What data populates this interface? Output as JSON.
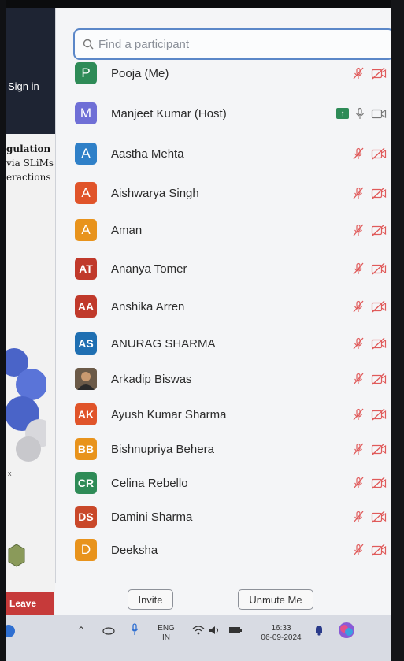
{
  "meeting": {
    "signin_label": "Sign in",
    "slide_title_lines": [
      "gulation",
      "via SLiMs",
      "eractions"
    ],
    "slide_small_text": "x",
    "leave_label": "Leave"
  },
  "panel": {
    "search_placeholder": "Find a participant",
    "invite_label": "Invite",
    "unmute_label": "Unmute Me",
    "participants": [
      {
        "initials": "P",
        "name": "Pooja (Me)",
        "color": "#2e8b57"
      },
      {
        "initials": "M",
        "name": "Manjeet Kumar (Host)",
        "color": "#6f6fd6"
      },
      {
        "initials": "A",
        "name": "Aastha Mehta",
        "color": "#2f80c8"
      },
      {
        "initials": "A",
        "name": "Aishwarya Singh",
        "color": "#e0542a"
      },
      {
        "initials": "A",
        "name": "Aman",
        "color": "#e8931c"
      },
      {
        "initials": "AT",
        "name": "Ananya Tomer",
        "color": "#c0392b"
      },
      {
        "initials": "AA",
        "name": "Anshika Arren",
        "color": "#c0392b"
      },
      {
        "initials": "AS",
        "name": "ANURAG SHARMA",
        "color": "#1f6fb2"
      },
      {
        "initials": "",
        "name": "Arkadip Biswas",
        "color": "#5a4a3a"
      },
      {
        "initials": "AK",
        "name": "Ayush Kumar Sharma",
        "color": "#e0542a"
      },
      {
        "initials": "BB",
        "name": "Bishnupriya Behera",
        "color": "#e8931c"
      },
      {
        "initials": "CR",
        "name": "Celina Rebello",
        "color": "#2e8b57"
      },
      {
        "initials": "DS",
        "name": "Damini Sharma",
        "color": "#c9482a"
      },
      {
        "initials": "D",
        "name": "Deeksha",
        "color": "#e8931c"
      }
    ]
  },
  "taskbar": {
    "lang_top": "ENG",
    "lang_bottom": "IN",
    "time": "16:33",
    "date": "06-09-2024"
  },
  "colors": {
    "muted_icon": "#e05a5a",
    "accent": "#5b87c8"
  }
}
